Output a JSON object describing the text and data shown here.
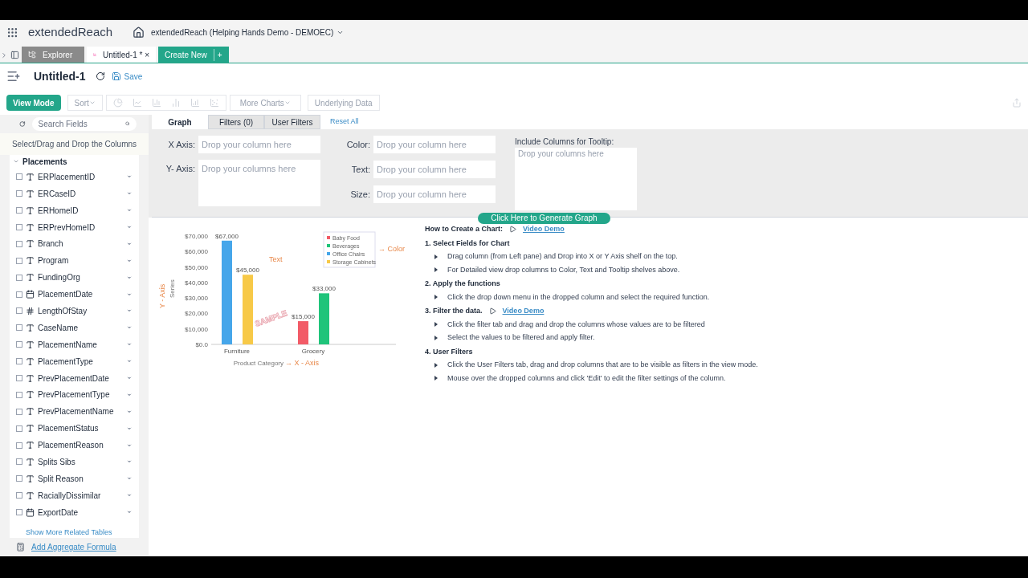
{
  "app": {
    "brand": "extendedReach",
    "workspace": "extendedReach (Helping Hands Demo - DEMOEC)"
  },
  "tabs": [
    {
      "label": "Explorer",
      "selected": false,
      "kind": "explorer"
    },
    {
      "label": "Untitled-1 * ×",
      "selected": true,
      "kind": "report"
    }
  ],
  "create_new": "Create New",
  "create_plus": "+",
  "title": "Untitled-1",
  "save": "Save",
  "toolbar": {
    "view_mode": "View Mode",
    "sort": "Sort",
    "more_charts": "More Charts",
    "underlying": "Underlying Data"
  },
  "sidebar": {
    "search_placeholder": "Search Fields",
    "hint": "Select/Drag and Drop the Columns",
    "table": "Placements",
    "expanded": true,
    "fields": [
      {
        "name": "ERPlacementID",
        "kind": "text",
        "checked": false
      },
      {
        "name": "ERCaseID",
        "kind": "text",
        "checked": false
      },
      {
        "name": "ERHomeID",
        "kind": "text",
        "checked": false
      },
      {
        "name": "ERPrevHomeID",
        "kind": "text",
        "checked": false
      },
      {
        "name": "Branch",
        "kind": "text",
        "checked": false
      },
      {
        "name": "Program",
        "kind": "text",
        "checked": false
      },
      {
        "name": "FundingOrg",
        "kind": "text",
        "checked": false
      },
      {
        "name": "PlacementDate",
        "kind": "date",
        "checked": false
      },
      {
        "name": "LengthOfStay",
        "kind": "number",
        "checked": false
      },
      {
        "name": "CaseName",
        "kind": "text",
        "checked": false
      },
      {
        "name": "PlacementName",
        "kind": "text",
        "checked": false
      },
      {
        "name": "PlacementType",
        "kind": "text",
        "checked": false
      },
      {
        "name": "PrevPlacementDate",
        "kind": "text",
        "checked": false
      },
      {
        "name": "PrevPlacementType",
        "kind": "text",
        "checked": false
      },
      {
        "name": "PrevPlacementName",
        "kind": "text",
        "checked": false
      },
      {
        "name": "PlacementStatus",
        "kind": "text",
        "checked": false
      },
      {
        "name": "PlacementReason",
        "kind": "text",
        "checked": false
      },
      {
        "name": "Splits Sibs",
        "kind": "text",
        "checked": false
      },
      {
        "name": "Split Reason",
        "kind": "text",
        "checked": false
      },
      {
        "name": "RaciallyDissimilar",
        "kind": "text",
        "checked": false
      },
      {
        "name": "ExportDate",
        "kind": "date",
        "checked": false
      }
    ],
    "more_tables": "Show More Related Tables",
    "aggregate": "Add Aggregate Formula"
  },
  "panel_tabs": [
    {
      "label": "Graph",
      "selected": true
    },
    {
      "label": "Filters (0)",
      "selected": false
    },
    {
      "label": "User Filters",
      "selected": false
    }
  ],
  "reset_all": "Reset All",
  "shelves": {
    "x_axis": {
      "label": "X Axis:",
      "placeholder": "Drop your column here"
    },
    "y_axis": {
      "label": "Y- Axis:",
      "placeholder": "Drop your columns here"
    },
    "color": {
      "label": "Color:",
      "placeholder": "Drop your column here"
    },
    "text": {
      "label": "Text:",
      "placeholder": "Drop your column here"
    },
    "size": {
      "label": "Size:",
      "placeholder": "Drop your column here"
    },
    "tooltip": {
      "label": "Include Columns for Tooltip:",
      "placeholder": "Drop your columns here"
    }
  },
  "generate": "Click Here to Generate Graph",
  "sample_chart": {
    "stamp": "SAMPLE",
    "series_label": "Series",
    "annotations": [
      {
        "kind": "text_note",
        "label": "Text"
      },
      {
        "kind": "legend_note",
        "label": "→ Color"
      },
      {
        "kind": "x_note",
        "label": "→  X - Axis"
      },
      {
        "kind": "y_note",
        "label": "Y - Axis"
      }
    ],
    "chart_data": {
      "type": "bar",
      "legend": "upper right",
      "xlabel": "Product Category",
      "categories": [
        "Furniture",
        "Grocery"
      ],
      "series": [
        {
          "name": "Baby Food",
          "color": "#f25b67",
          "values": [
            null,
            15000
          ]
        },
        {
          "name": "Beverages",
          "color": "#1fc47a",
          "values": [
            null,
            33000
          ]
        },
        {
          "name": "Office Chairs",
          "color": "#46a6ea",
          "values": [
            67000,
            null
          ]
        },
        {
          "name": "Storage Cabinets",
          "color": "#f7c948",
          "values": [
            45000,
            null
          ]
        }
      ],
      "ylim": [
        0,
        70000
      ],
      "yticks": [
        {
          "value": 0,
          "label": "$0.0"
        },
        {
          "value": 10000,
          "label": "$10,000"
        },
        {
          "value": 20000,
          "label": "$20,000"
        },
        {
          "value": 30000,
          "label": "$30,000"
        },
        {
          "value": 40000,
          "label": "$40,000"
        },
        {
          "value": 50000,
          "label": "$50,000"
        },
        {
          "value": 60000,
          "label": "$60,000"
        },
        {
          "value": 70000,
          "label": "$70,000"
        }
      ],
      "value_labels": [
        [
          "$67,000",
          "$45,000"
        ],
        [
          "$15,000",
          "$33,000"
        ]
      ]
    }
  },
  "howto": {
    "title": "How to Create a Chart:",
    "demo": "Video Demo",
    "steps": [
      {
        "title": "1. Select Fields for Chart",
        "items": [
          "Drag column (from Left pane) and Drop into X or Y Axis shelf on the top.",
          "For Detailed view drop columns to Color, Text and Tooltip shelves above."
        ]
      },
      {
        "title": "2. Apply the functions",
        "items": [
          "Click the drop down menu in the dropped column and select the required function."
        ]
      },
      {
        "title": "3. Filter the data.",
        "demo": "Video Demo",
        "items": [
          "Click the filter tab and drag and drop the columns whose values are to be filtered",
          "Select the values to be filtered and apply filter."
        ]
      },
      {
        "title": "4. User Filters",
        "items": [
          "Click the User Filters tab, drag and drop columns that are to be visible as filters in the view mode.",
          "Mouse over the dropped columns and click 'Edit' to edit the filter settings of the column."
        ]
      }
    ]
  }
}
